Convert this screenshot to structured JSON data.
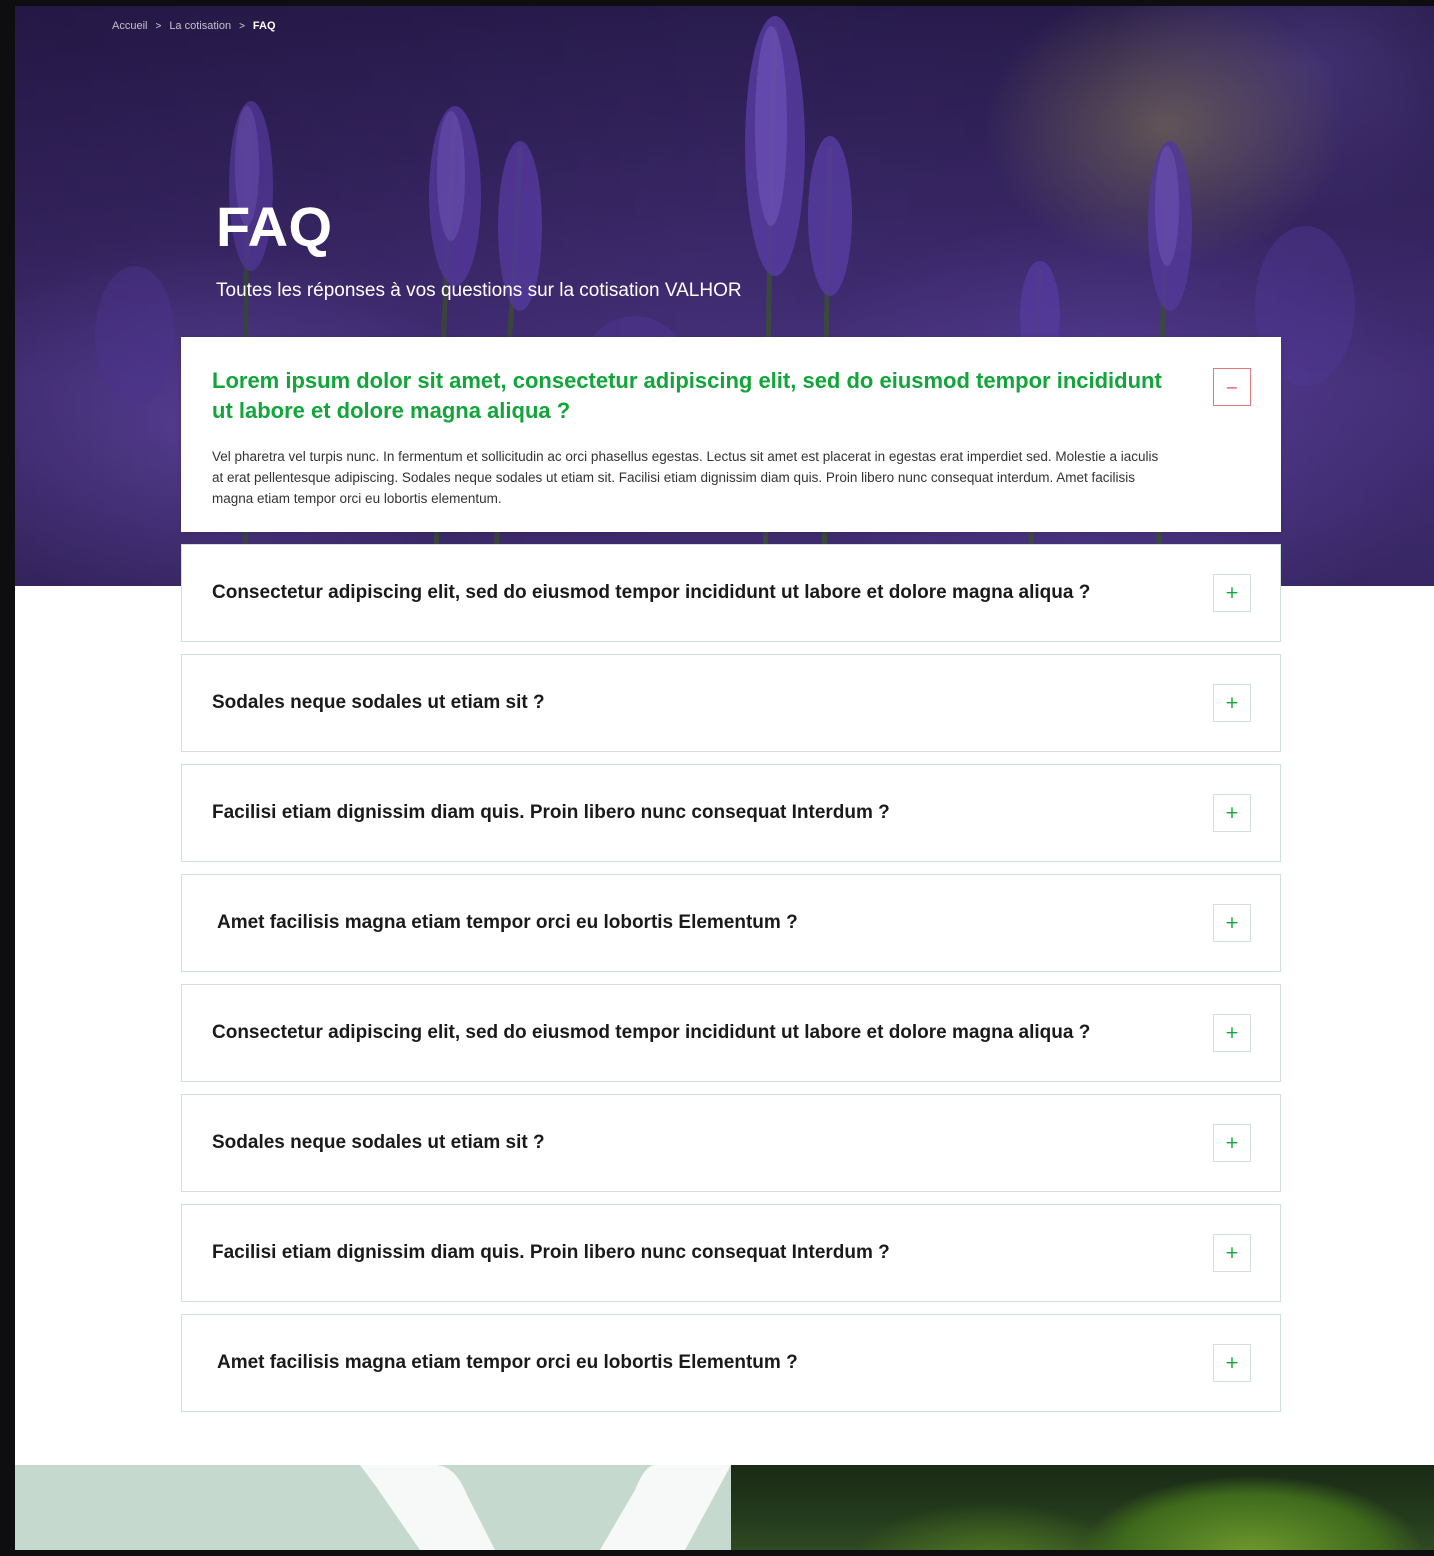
{
  "breadcrumb": {
    "items": [
      "Accueil",
      "La cotisation"
    ],
    "current": "FAQ",
    "separator": ">"
  },
  "hero": {
    "title": "FAQ",
    "subtitle": "Toutes les réponses à vos questions sur la cotisation VALHOR"
  },
  "colors": {
    "accent_green": "#12a53a",
    "close_red": "#e05a5c",
    "border": "#cfe0de"
  },
  "icons": {
    "open_toggle": "minus-icon",
    "closed_toggle": "plus-icon"
  },
  "faq": {
    "open_item": {
      "question": "Lorem ipsum dolor sit amet, consectetur adipiscing elit, sed do eiusmod tempor incididunt ut labore et dolore magna aliqua ?",
      "answer": "Vel pharetra vel turpis nunc. In fermentum et sollicitudin ac orci phasellus egestas. Lectus sit amet est placerat in egestas erat imperdiet sed. Molestie a iaculis at erat pellentesque adipiscing. Sodales neque sodales ut etiam sit. Facilisi etiam dignissim diam quis. Proin libero nunc consequat interdum. Amet facilisis magna etiam tempor orci eu lobortis elementum.",
      "toggle": "−"
    },
    "items": [
      {
        "question": "Consectetur adipiscing elit, sed do eiusmod tempor incididunt ut labore et dolore magna aliqua ?",
        "toggle": "+"
      },
      {
        "question": "Sodales neque sodales ut etiam sit ?",
        "toggle": "+"
      },
      {
        "question": "Facilisi etiam dignissim diam quis. Proin libero nunc consequat Interdum ?",
        "toggle": "+"
      },
      {
        "question": "Amet facilisis magna etiam tempor orci eu lobortis Elementum ?",
        "toggle": "+"
      },
      {
        "question": "Consectetur adipiscing elit, sed do eiusmod tempor incididunt ut labore et dolore magna aliqua ?",
        "toggle": "+"
      },
      {
        "question": "Sodales neque sodales ut etiam sit ?",
        "toggle": "+"
      },
      {
        "question": "Facilisi etiam dignissim diam quis. Proin libero nunc consequat Interdum ?",
        "toggle": "+"
      },
      {
        "question": "Amet facilisis magna etiam tempor orci eu lobortis Elementum ?",
        "toggle": "+"
      }
    ]
  }
}
